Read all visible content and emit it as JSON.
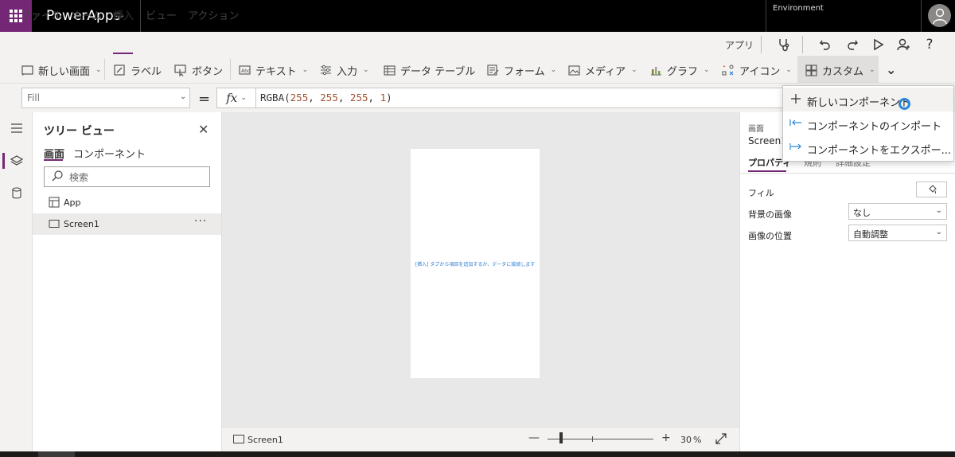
{
  "topbar": {
    "app_title": "PowerApps",
    "environment_label": "Environment"
  },
  "menu": {
    "items": [
      {
        "label": "ファイル",
        "active": false
      },
      {
        "label": "ホーム",
        "active": false
      },
      {
        "label": "挿入",
        "active": true
      },
      {
        "label": "ビュー",
        "active": false
      },
      {
        "label": "アクション",
        "active": false
      }
    ],
    "apps_label": "アプリ"
  },
  "ribbon": {
    "new_screen": "新しい画面",
    "label": "ラベル",
    "button": "ボタン",
    "text": "テキスト",
    "input": "入力",
    "data_table": "データ テーブル",
    "form": "フォーム",
    "media": "メディア",
    "chart": "グラフ",
    "icons": "アイコン",
    "custom": "カスタム"
  },
  "formula_bar": {
    "property": "Fill",
    "fx": "fx",
    "formula_fn": "RGBA(",
    "formula_args": [
      "255",
      "255",
      "255",
      "1"
    ],
    "formula_close": ")"
  },
  "tree_view": {
    "title": "ツリー ビュー",
    "tabs": [
      {
        "label": "画面",
        "active": true
      },
      {
        "label": "コンポーネント",
        "active": false
      }
    ],
    "search_placeholder": "検索",
    "items": [
      {
        "label": "App",
        "selected": false
      },
      {
        "label": "Screen1",
        "selected": true
      }
    ],
    "more": "···"
  },
  "canvas": {
    "hint": "[挿入] タブから項目を追加するか、データに接続します"
  },
  "statusbar": {
    "screen_label": "Screen1",
    "zoom_value": "30",
    "zoom_unit": "%",
    "zoom_fraction": 0.3
  },
  "properties": {
    "type_label": "画面",
    "name": "Screen1",
    "tabs": [
      {
        "label": "プロパティ",
        "active": true
      },
      {
        "label": "規則",
        "active": false
      },
      {
        "label": "詳細設定",
        "active": false
      }
    ],
    "fill_label": "フィル",
    "bg_image_label": "背景の画像",
    "bg_image_value": "なし",
    "image_position_label": "画像の位置",
    "image_position_value": "自動調整"
  },
  "custom_menu": {
    "items": [
      {
        "label": "新しいコンポーネント",
        "icon": "plus-icon"
      },
      {
        "label": "コンポーネントのインポート",
        "icon": "import-arrow-icon"
      },
      {
        "label": "コンポーネントをエクスポー...",
        "icon": "export-arrow-icon"
      }
    ]
  },
  "colors": {
    "brand": "#742774",
    "accent_blue": "#2b88d8",
    "topbar": "#000000",
    "chrome": "#f3f2f1"
  }
}
